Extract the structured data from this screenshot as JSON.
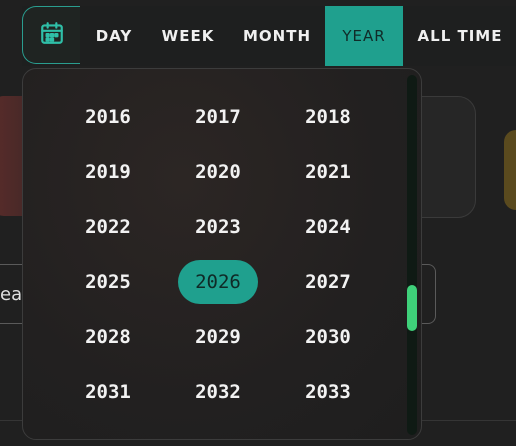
{
  "background": {
    "field_text": "ea"
  },
  "calendar_button": {
    "icon": "calendar-icon"
  },
  "tabs": [
    {
      "label": "DAY",
      "active": false
    },
    {
      "label": "WEEK",
      "active": false
    },
    {
      "label": "MONTH",
      "active": false
    },
    {
      "label": "YEAR",
      "active": true
    },
    {
      "label": "ALL TIME",
      "active": false
    }
  ],
  "year_picker": {
    "selected": "2026",
    "years": [
      "2016",
      "2017",
      "2018",
      "2019",
      "2020",
      "2021",
      "2022",
      "2023",
      "2024",
      "2025",
      "2026",
      "2027",
      "2028",
      "2029",
      "2030",
      "2031",
      "2032",
      "2033"
    ]
  },
  "colors": {
    "accent": "#1fa08e",
    "scroll_thumb": "#3fd17a"
  }
}
